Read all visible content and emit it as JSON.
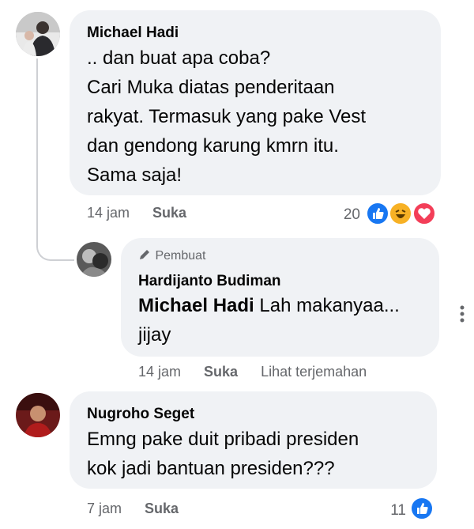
{
  "comments": [
    {
      "author": "Michael Hadi",
      "lines": [
        ".. dan buat apa coba?",
        "Cari Muka diatas penderitaan",
        "rakyat. Termasuk yang pake Vest",
        "dan gendong karung kmrn itu.",
        "Sama saja!"
      ],
      "time": "14 jam",
      "like": "Suka",
      "reaction_count": "20",
      "reactions": [
        "like-icon",
        "haha-icon",
        "love-icon"
      ]
    },
    {
      "badge_icon": "pen-icon",
      "badge": "Pembuat",
      "author": "Hardijanto Budiman",
      "mention": "Michael Hadi",
      "lines": [
        " Lah makanyaa...",
        "jijay"
      ],
      "time": "14 jam",
      "like": "Suka",
      "translate": "Lihat terjemahan",
      "more_icon": "more-options-icon"
    },
    {
      "author": "Nugroho Seget",
      "lines": [
        "Emng pake duit pribadi presiden",
        "kok jadi bantuan presiden???"
      ],
      "time": "7 jam",
      "like": "Suka",
      "reaction_count": "11",
      "reactions": [
        "like-icon"
      ]
    }
  ],
  "colors": {
    "bubble": "#f0f2f5",
    "text": "#050505",
    "meta": "#65676b",
    "like": "#1877f2",
    "haha": "#f7b125",
    "love": "#f33e58"
  }
}
